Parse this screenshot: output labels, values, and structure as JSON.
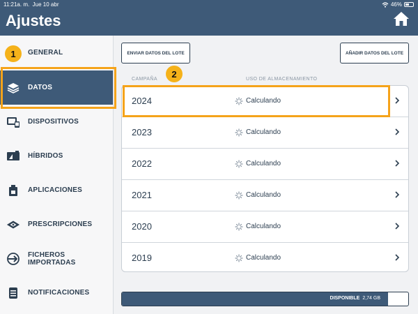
{
  "status": {
    "time": "11:21a. m.",
    "date": "Jue 10 abr",
    "battery": "46%"
  },
  "header": {
    "title": "Ajustes"
  },
  "sidebar": {
    "items": [
      {
        "label": "GENERAL",
        "icon": "globe-icon"
      },
      {
        "label": "DATOS",
        "icon": "layers-icon",
        "active": true
      },
      {
        "label": "DISPOSITIVOS",
        "icon": "devices-icon"
      },
      {
        "label": "HÍBRIDOS",
        "icon": "hybrids-icon"
      },
      {
        "label": "APLICACIONES",
        "icon": "applications-icon"
      },
      {
        "label": "PRESCRIPCIONES",
        "icon": "prescriptions-icon"
      },
      {
        "label": "FICHEROS IMPORTADAS",
        "icon": "import-icon"
      },
      {
        "label": "NOTIFICACIONES",
        "icon": "notifications-icon"
      }
    ]
  },
  "callouts": {
    "one": "1",
    "two": "2"
  },
  "toolbar": {
    "send_label": "ENVIAR DATOS DEL LOTE",
    "add_label": "AÑADIR DATOS DEL LOTE"
  },
  "table": {
    "columns": {
      "campaign": "CAMPAÑA",
      "usage": "USO DE ALMACENAMIENTO"
    },
    "rows": [
      {
        "year": "2024",
        "usage": "Calculando"
      },
      {
        "year": "2023",
        "usage": "Calculando"
      },
      {
        "year": "2022",
        "usage": "Calculando"
      },
      {
        "year": "2021",
        "usage": "Calculando"
      },
      {
        "year": "2020",
        "usage": "Calculando"
      },
      {
        "year": "2019",
        "usage": "Calculando"
      }
    ]
  },
  "storage": {
    "label": "DISPONIBLE",
    "value": "2,74 GB",
    "used_fraction": 0.93
  },
  "colors": {
    "header": "#3e5a78",
    "accent": "#f5a31a",
    "text": "#2c3e50"
  }
}
